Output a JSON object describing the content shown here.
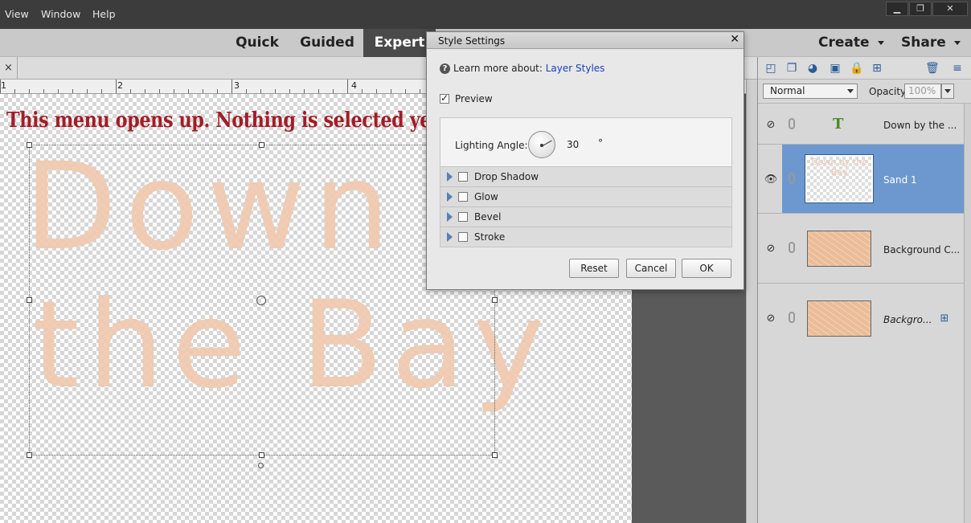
{
  "menubar": {
    "items": [
      "View",
      "Window",
      "Help"
    ],
    "window_controls": [
      "▁",
      "❐",
      "✕"
    ]
  },
  "modebar": {
    "tabs": [
      "Quick",
      "Guided",
      "Expert"
    ],
    "active_tab": "Expert",
    "create_label": "Create",
    "share_label": "Share"
  },
  "document": {
    "close_glyph": "×",
    "ruler_numbers": [
      "1",
      "2",
      "3",
      "4"
    ],
    "annotation": "This menu opens up. Nothing is selected yet.",
    "art_line1": "Down by",
    "art_line2": "the Bay"
  },
  "dialog": {
    "title": "Style Settings",
    "close_glyph": "✕",
    "help_glyph": "?",
    "learn_more": "Learn more about:",
    "learn_link": "Layer Styles",
    "preview_label": "Preview",
    "preview_checked": true,
    "lighting_angle_label": "Lighting Angle:",
    "lighting_angle_value": "30",
    "degree_symbol": "°",
    "effects": [
      "Drop Shadow",
      "Glow",
      "Bevel",
      "Stroke"
    ],
    "buttons": {
      "reset": "Reset",
      "cancel": "Cancel",
      "ok": "OK"
    }
  },
  "layers_panel": {
    "blend_mode": "Normal",
    "opacity_label": "Opacity:",
    "opacity_value": "100%",
    "layers": [
      {
        "name": "Down by the ...",
        "type": "text",
        "visible": false,
        "selected": false
      },
      {
        "name": "Sand 1",
        "type": "image",
        "visible": true,
        "selected": true,
        "thumb_text": "Down by the Bay"
      },
      {
        "name": "Background C...",
        "type": "image",
        "visible": false,
        "selected": false
      },
      {
        "name": "Backgro...",
        "type": "background",
        "visible": false,
        "selected": false,
        "locked": true
      }
    ],
    "text_layer_glyph": "T"
  },
  "colors": {
    "annotation": "#a21d26",
    "selected_layer": "#6c98cf",
    "link": "#1a3fb8"
  }
}
